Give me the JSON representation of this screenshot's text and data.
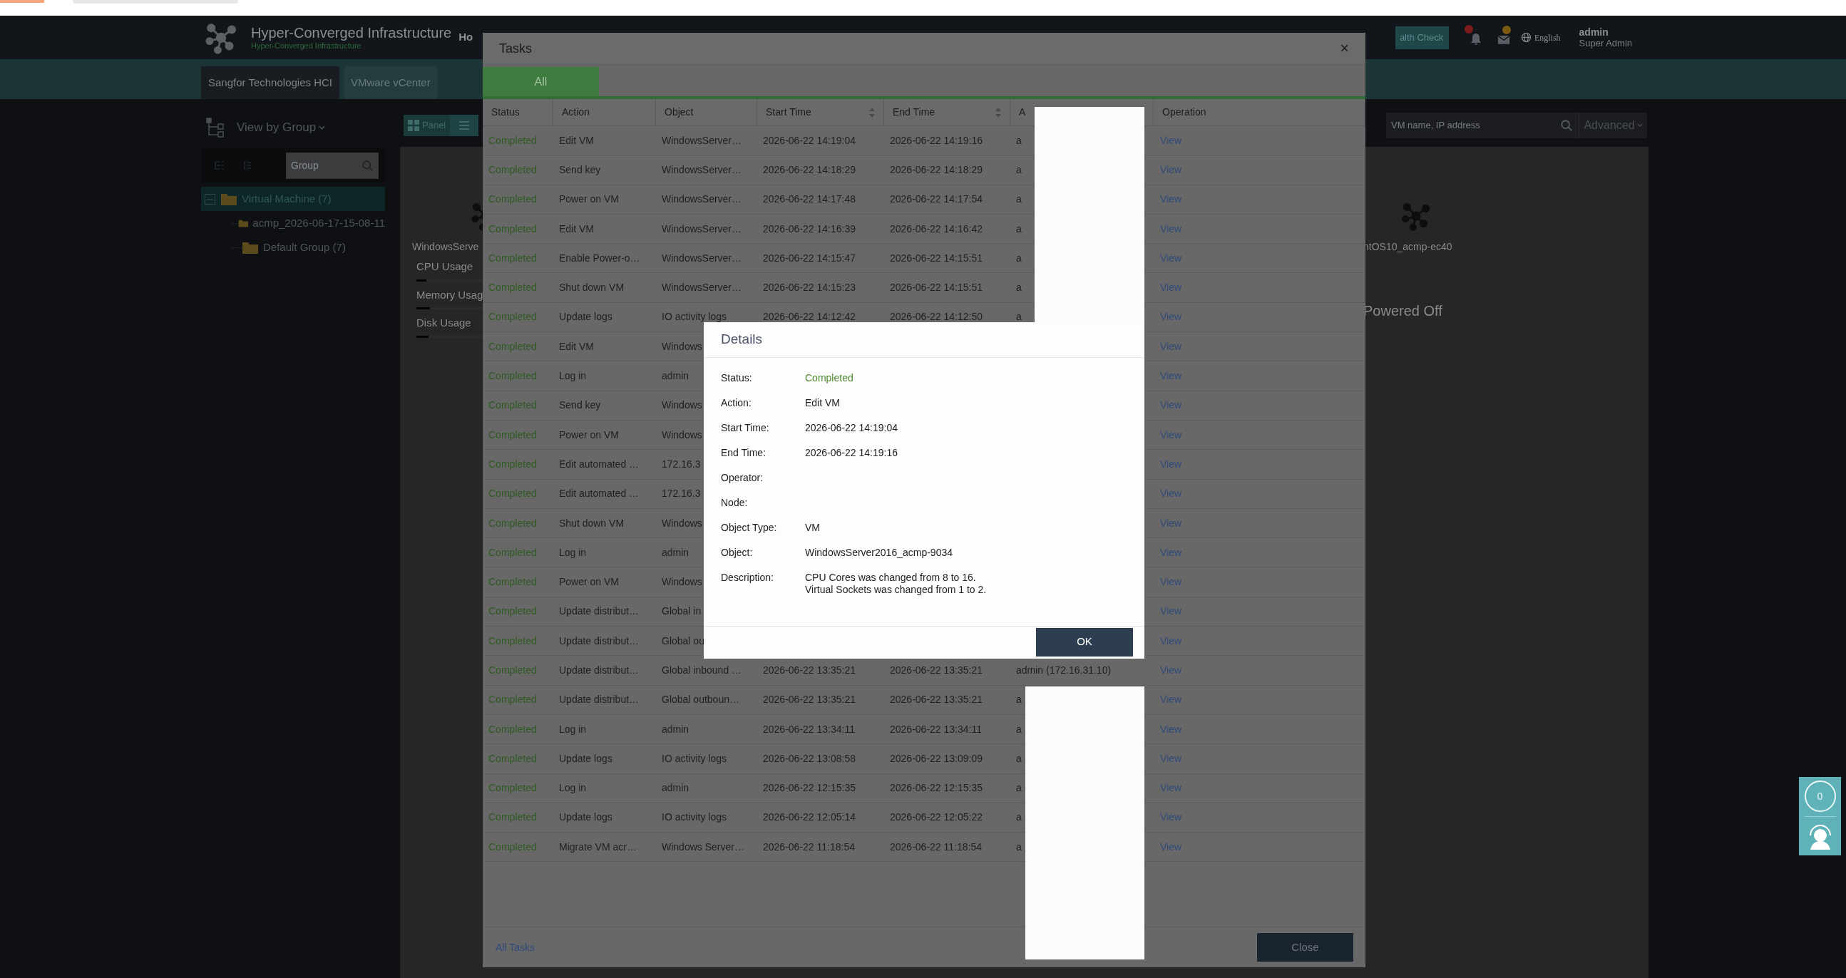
{
  "header": {
    "product": "Hyper-Converged Infrastructure",
    "subtitle": "Hyper-Converged Infrastructure",
    "nav_item": "Ho",
    "health_check": "alth Check",
    "language": "English",
    "user": {
      "name": "admin",
      "role": "Super Admin"
    }
  },
  "platform_tabs": [
    {
      "label": "Sangfor Technologies HCI",
      "selected": true
    },
    {
      "label": "VMware vCenter",
      "selected": false
    }
  ],
  "sidebar": {
    "view_selector": "View by Group",
    "search": {
      "placeholder": "Group"
    },
    "tree": [
      {
        "label": "Virtual Machine (7)",
        "selected": true,
        "expanded": true,
        "children": [
          {
            "label": "acmp_2026-06-17-15-08-11",
            "selected": false
          },
          {
            "label": "Default Group (7)",
            "selected": false
          }
        ]
      }
    ]
  },
  "toolbar": {
    "view_buttons": [
      {
        "kind": "panel",
        "label": "Panel"
      },
      {
        "kind": "list"
      }
    ],
    "search": {
      "placeholder": "VM name, IP address"
    },
    "advanced": "Advanced"
  },
  "vm_cards": [
    {
      "name": "WindowsServe",
      "metrics": [
        {
          "label": "CPU Usage",
          "level": 0.12
        },
        {
          "label": "Memory Usag",
          "level": 0.16
        },
        {
          "label": "Disk Usage",
          "level": 0.14
        }
      ]
    },
    {
      "name": "ntOS10_acmp-ec40",
      "status": "Powered Off"
    }
  ],
  "tasks_dialog": {
    "title": "Tasks",
    "close": "×",
    "tabs": [
      {
        "label": "All",
        "selected": true
      }
    ],
    "columns": [
      {
        "label": "Status"
      },
      {
        "label": "Action"
      },
      {
        "label": "Object"
      },
      {
        "label": "Start Time",
        "sortable": true
      },
      {
        "label": "End Time",
        "sortable": true
      },
      {
        "label": "A"
      },
      {
        "label": "Operation"
      }
    ],
    "rows": [
      {
        "status": "Completed",
        "action": "Edit VM",
        "object": "WindowsServer…",
        "start_time": "2026-06-22 14:19:04",
        "end_time": "2026-06-22 14:19:16",
        "column_6": "a",
        "operation": "View"
      },
      {
        "status": "Completed",
        "action": "Send key",
        "object": "WindowsServer…",
        "start_time": "2026-06-22 14:18:29",
        "end_time": "2026-06-22 14:18:29",
        "column_6": "a",
        "operation": "View"
      },
      {
        "status": "Completed",
        "action": "Power on VM",
        "object": "WindowsServer…",
        "start_time": "2026-06-22 14:17:48",
        "end_time": "2026-06-22 14:17:54",
        "column_6": "a",
        "operation": "View"
      },
      {
        "status": "Completed",
        "action": "Edit VM",
        "object": "WindowsServer…",
        "start_time": "2026-06-22 14:16:39",
        "end_time": "2026-06-22 14:16:42",
        "column_6": "a",
        "operation": "View"
      },
      {
        "status": "Completed",
        "action": "Enable Power-o…",
        "object": "WindowsServer…",
        "start_time": "2026-06-22 14:15:47",
        "end_time": "2026-06-22 14:15:51",
        "column_6": "a",
        "operation": "View"
      },
      {
        "status": "Completed",
        "action": "Shut down VM",
        "object": "WindowsServer…",
        "start_time": "2026-06-22 14:15:23",
        "end_time": "2026-06-22 14:15:51",
        "column_6": "a",
        "operation": "View"
      },
      {
        "status": "Completed",
        "action": "Update logs",
        "object": "IO activity logs",
        "start_time": "2026-06-22 14:12:42",
        "end_time": "2026-06-22 14:12:50",
        "column_6": "a",
        "operation": "View"
      },
      {
        "status": "Completed",
        "action": "Edit VM",
        "object": "Windows",
        "operation": "View"
      },
      {
        "status": "Completed",
        "action": "Log in",
        "object": "admin",
        "operation": "View"
      },
      {
        "status": "Completed",
        "action": "Send key",
        "object": "Windows",
        "operation": "View"
      },
      {
        "status": "Completed",
        "action": "Power on VM",
        "object": "Windows",
        "operation": "View"
      },
      {
        "status": "Completed",
        "action": "Edit automated …",
        "object": "172.16.3",
        "operation": "View"
      },
      {
        "status": "Completed",
        "action": "Edit automated …",
        "object": "172.16.3",
        "operation": "View"
      },
      {
        "status": "Completed",
        "action": "Shut down VM",
        "object": "Windows",
        "operation": "View"
      },
      {
        "status": "Completed",
        "action": "Log in",
        "object": "admin",
        "operation": "View"
      },
      {
        "status": "Completed",
        "action": "Power on VM",
        "object": "Windows",
        "operation": "View"
      },
      {
        "status": "Completed",
        "action": "Update distribut…",
        "object": "Global in",
        "operation": "View"
      },
      {
        "status": "Completed",
        "action": "Update distribut…",
        "object": "Global ou",
        "operation": "View"
      },
      {
        "status": "Completed",
        "action": "Update distribut…",
        "object": "Global inbound …",
        "start_time": "2026-06-22 13:35:21",
        "end_time": "2026-06-22 13:35:21",
        "column_6": "admin (172.16.31.10)",
        "operation": "View"
      },
      {
        "status": "Completed",
        "action": "Update distribut…",
        "object": "Global outboun…",
        "start_time": "2026-06-22 13:35:21",
        "end_time": "2026-06-22 13:35:21",
        "column_6": "a",
        "operation": "View"
      },
      {
        "status": "Completed",
        "action": "Log in",
        "object": "admin",
        "start_time": "2026-06-22 13:34:11",
        "end_time": "2026-06-22 13:34:11",
        "column_6": "a",
        "operation": "View"
      },
      {
        "status": "Completed",
        "action": "Update logs",
        "object": "IO activity logs",
        "start_time": "2026-06-22 13:08:58",
        "end_time": "2026-06-22 13:09:09",
        "column_6": "a",
        "operation": "View"
      },
      {
        "status": "Completed",
        "action": "Log in",
        "object": "admin",
        "start_time": "2026-06-22 12:15:35",
        "end_time": "2026-06-22 12:15:35",
        "column_6": "a",
        "operation": "View"
      },
      {
        "status": "Completed",
        "action": "Update logs",
        "object": "IO activity logs",
        "start_time": "2026-06-22 12:05:14",
        "end_time": "2026-06-22 12:05:22",
        "column_6": "a",
        "operation": "View"
      },
      {
        "status": "Completed",
        "action": "Migrate VM acr…",
        "object": "Windows Server…",
        "start_time": "2026-06-22 11:18:54",
        "end_time": "2026-06-22 11:18:54",
        "column_6": "a",
        "operation": "View"
      }
    ],
    "footer_link": "All Tasks",
    "close_button": "Close"
  },
  "details_dialog": {
    "title": "Details",
    "fields": [
      {
        "label": "Status:",
        "value": "Completed",
        "kind": "status"
      },
      {
        "label": "Action:",
        "value": "Edit VM"
      },
      {
        "label": "Start Time:",
        "value": "2026-06-22 14:19:04"
      },
      {
        "label": "End Time:",
        "value": "2026-06-22 14:19:16"
      },
      {
        "label": "Operator:"
      },
      {
        "label": "Node:"
      },
      {
        "label": "Object Type:",
        "value": "VM"
      },
      {
        "label": "Object:",
        "value": "WindowsServer2016_acmp-9034"
      },
      {
        "label": "Description:",
        "value": "CPU Cores was changed from 8 to 16.\nVirtual Sockets was changed from 1 to 2."
      }
    ],
    "ok_button": "OK"
  },
  "support_widget": {
    "count": "0"
  }
}
